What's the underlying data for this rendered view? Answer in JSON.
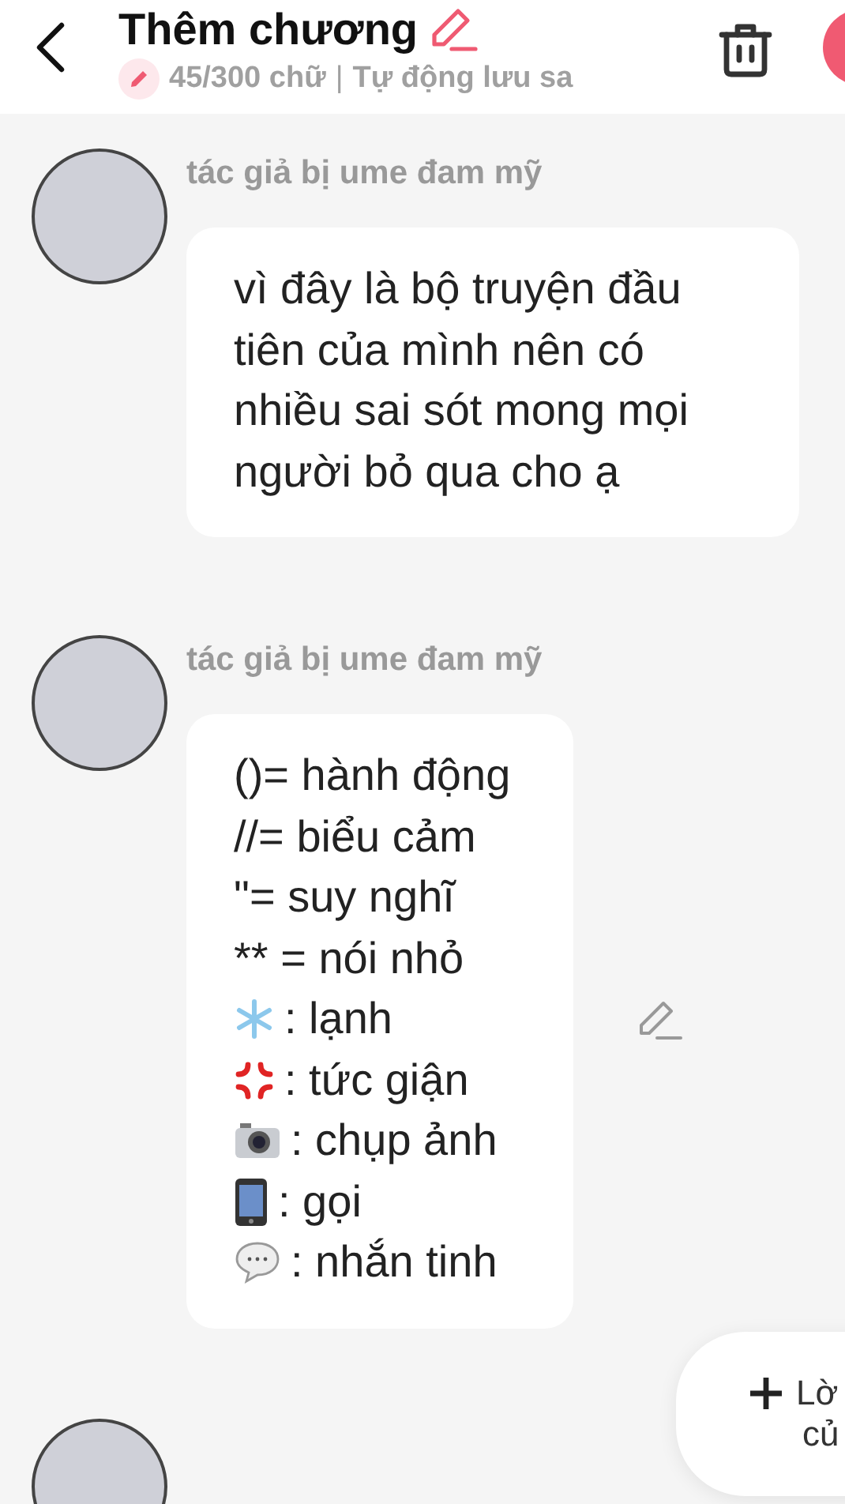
{
  "header": {
    "title": "Thêm chương",
    "word_count": "45/300 chữ",
    "separator": "|",
    "autosave": "Tự động lưu sa"
  },
  "messages": [
    {
      "author": "tác giả bị ume đam mỹ",
      "lines": [
        {
          "kind": "text",
          "text": "vì đây là bộ truyện đầu tiên của mình nên có nhiều sai sót mong mọi người bỏ qua cho ạ"
        }
      ]
    },
    {
      "author": "tác giả bị ume đam mỹ",
      "editable": true,
      "lines": [
        {
          "kind": "text",
          "text": "()= hành động"
        },
        {
          "kind": "text",
          "text": "//= biểu cảm"
        },
        {
          "kind": "text",
          "text": "\"= suy nghĩ"
        },
        {
          "kind": "text",
          "text": "** = nói nhỏ"
        },
        {
          "kind": "icon",
          "text": ": lạnh"
        },
        {
          "kind": "icon",
          "text": ": tức giận"
        },
        {
          "kind": "icon",
          "text": ": chụp ảnh"
        },
        {
          "kind": "icon",
          "text": ": gọi"
        },
        {
          "kind": "icon",
          "text": ": nhắn tinh"
        }
      ]
    }
  ],
  "fab": {
    "line_1": "Lờ",
    "line_2": "củ"
  }
}
